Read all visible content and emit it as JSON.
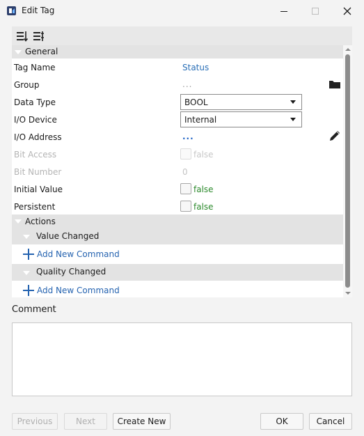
{
  "window": {
    "title": "Edit Tag"
  },
  "icons": {
    "app": "tag-app-icon",
    "sort_ascending": "sort-list-icon",
    "sort_categorized": "categorize-list-icon",
    "folder": "folder-icon",
    "pencil": "pencil-icon",
    "minimize": "minimize-icon",
    "maximize": "maximize-icon",
    "close": "close-icon"
  },
  "grid": {
    "general": {
      "label": "General",
      "rows": {
        "tag_name": {
          "label": "Tag Name",
          "value": "Status"
        },
        "group": {
          "label": "Group",
          "value": "..."
        },
        "data_type": {
          "label": "Data Type",
          "value": "BOOL"
        },
        "io_device": {
          "label": "I/O Device",
          "value": "Internal"
        },
        "io_address": {
          "label": "I/O Address",
          "value": "..."
        },
        "bit_access": {
          "label": "Bit Access",
          "value": "false"
        },
        "bit_number": {
          "label": "Bit Number",
          "value": "0"
        },
        "initial_value": {
          "label": "Initial Value",
          "value": "false"
        },
        "persistent": {
          "label": "Persistent",
          "value": "false"
        }
      }
    },
    "actions": {
      "label": "Actions",
      "value_changed": {
        "label": "Value Changed",
        "add_command": "Add New Command"
      },
      "quality_changed": {
        "label": "Quality Changed",
        "add_command": "Add New Command"
      }
    }
  },
  "comment": {
    "label": "Comment",
    "value": ""
  },
  "buttons": {
    "previous": "Previous",
    "next": "Next",
    "create_new": "Create New",
    "ok": "OK",
    "cancel": "Cancel"
  },
  "colors": {
    "link_blue": "#2a6fb7",
    "false_green": "#2e8b2e",
    "category_bg": "#e3e3e3"
  }
}
